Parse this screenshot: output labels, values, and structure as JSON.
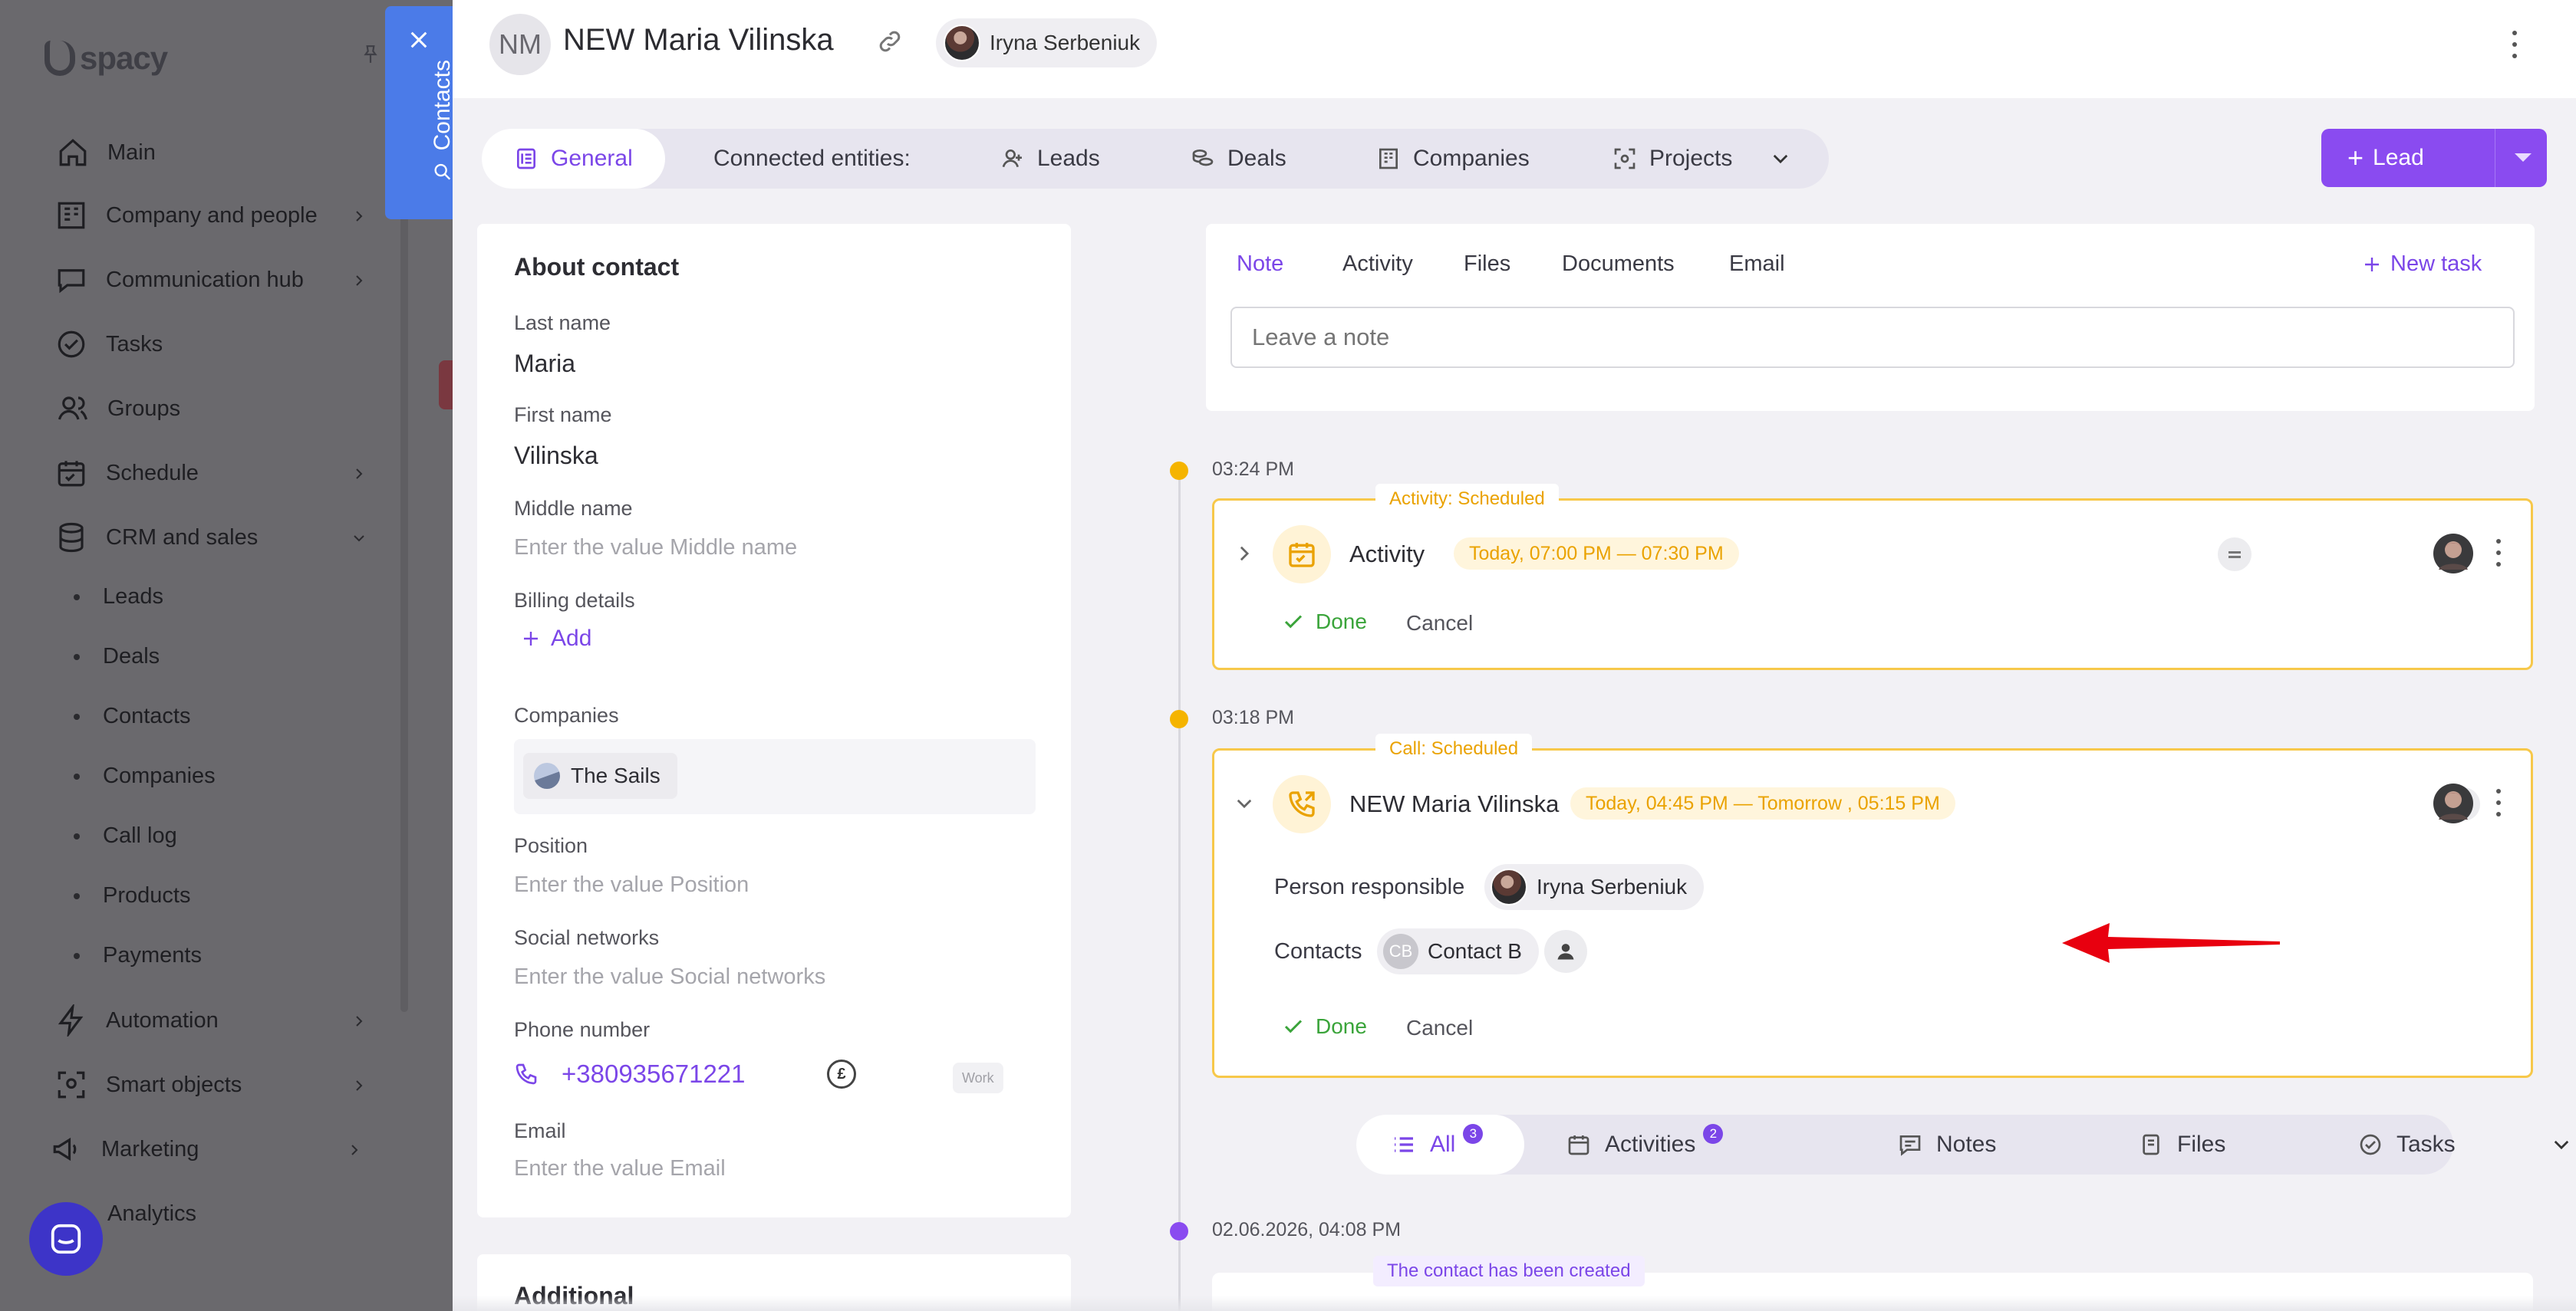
{
  "sidebar": {
    "logo": "spacy",
    "items": [
      {
        "label": "Main",
        "icon": "home-icon"
      },
      {
        "label": "Company and people",
        "icon": "building-icon"
      },
      {
        "label": "Communication hub",
        "icon": "chat-icon"
      },
      {
        "label": "Tasks",
        "icon": "check-circle-icon"
      },
      {
        "label": "Groups",
        "icon": "people-icon"
      },
      {
        "label": "Schedule",
        "icon": "calendar-icon"
      },
      {
        "label": "CRM and sales",
        "icon": "database-icon"
      },
      {
        "label": "Automation",
        "icon": "bolt-icon"
      },
      {
        "label": "Smart objects",
        "icon": "scan-icon"
      },
      {
        "label": "Marketing",
        "icon": "megaphone-icon"
      },
      {
        "label": "Analytics",
        "icon": "chart-icon"
      }
    ],
    "crm_subitems": [
      "Leads",
      "Deals",
      "Contacts",
      "Companies",
      "Call log",
      "Products",
      "Payments"
    ]
  },
  "contacts_tab": {
    "label": "Contacts"
  },
  "header": {
    "avatar_initials": "NM",
    "title": "NEW Maria Vilinska",
    "owner_name": "Iryna Serbeniuk"
  },
  "entity_tabs": {
    "general": "General",
    "connected_label": "Connected entities:",
    "leads": "Leads",
    "deals": "Deals",
    "companies": "Companies",
    "projects": "Projects"
  },
  "lead_button": {
    "label": "Lead"
  },
  "about": {
    "heading": "About contact",
    "last_name_label": "Last name",
    "last_name": "Maria",
    "first_name_label": "First name",
    "first_name": "Vilinska",
    "middle_name_label": "Middle name",
    "middle_name_placeholder": "Enter the value Middle name",
    "billing_label": "Billing details",
    "billing_add": "Add",
    "companies_label": "Companies",
    "company_name": "The Sails",
    "position_label": "Position",
    "position_placeholder": "Enter the value Position",
    "social_label": "Social networks",
    "social_placeholder": "Enter the value Social networks",
    "phone_label": "Phone number",
    "phone": "+380935671221",
    "phone_type": "Work",
    "email_label": "Email",
    "email_placeholder": "Enter the value Email"
  },
  "additional": {
    "heading": "Additional"
  },
  "note_panel": {
    "tabs": [
      "Note",
      "Activity",
      "Files",
      "Documents",
      "Email"
    ],
    "new_task": "New task",
    "placeholder": "Leave a note"
  },
  "timeline": {
    "entries": [
      {
        "time": "03:24 PM",
        "badge": "Activity: Scheduled",
        "title": "Activity",
        "when": "Today, 07:00 PM — 07:30 PM",
        "done": "Done",
        "cancel": "Cancel"
      },
      {
        "time": "03:18 PM",
        "badge": "Call: Scheduled",
        "title": "NEW Maria Vilinska",
        "when": "Today, 04:45 PM — Tomorrow , 05:15 PM",
        "responsible_label": "Person responsible",
        "responsible_name": "Iryna Serbeniuk",
        "contacts_label": "Contacts",
        "contact_initials": "CB",
        "contact_name": "Contact B",
        "done": "Done",
        "cancel": "Cancel"
      }
    ],
    "filters": {
      "all": "All",
      "all_count": "3",
      "activities": "Activities",
      "activities_count": "2",
      "notes": "Notes",
      "files": "Files",
      "tasks": "Tasks"
    },
    "created": {
      "time": "02.06.2026, 04:08 PM",
      "badge": "The contact has been created"
    }
  },
  "colors": {
    "accent": "#7b46e8",
    "lead_button": "#8a4bf0",
    "scheduled": "#eaa200",
    "done": "#3aa43a",
    "contacts_tab": "#4b7be8",
    "arrow": "#e8000f"
  }
}
